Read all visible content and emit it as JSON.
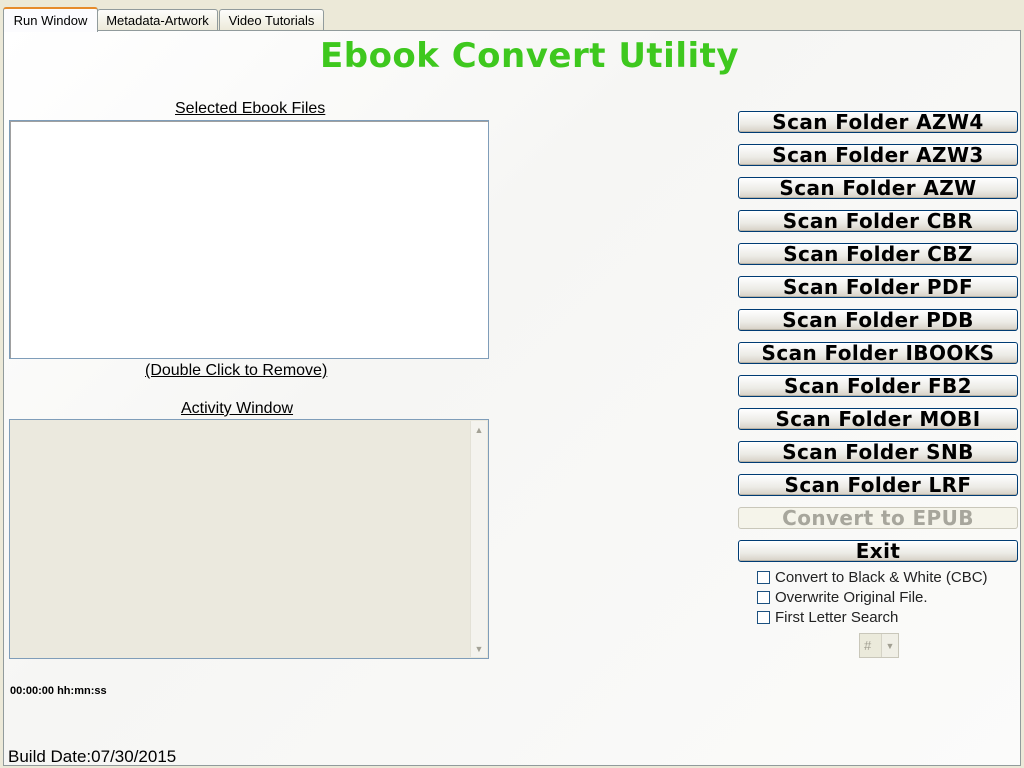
{
  "tabs": [
    {
      "label": "Run Window"
    },
    {
      "label": "Metadata-Artwork"
    },
    {
      "label": "Video Tutorials"
    }
  ],
  "title": "Ebook Convert Utility",
  "files_caption": "Selected Ebook Files",
  "remove_hint": "(Double Click to Remove)",
  "activity_caption": "Activity Window",
  "timer": "00:00:00 hh:mn:ss",
  "build_date": "Build Date:07/30/2015",
  "buttons": [
    {
      "label": "Scan Folder AZW4"
    },
    {
      "label": "Scan Folder AZW3"
    },
    {
      "label": "Scan Folder AZW"
    },
    {
      "label": "Scan Folder CBR"
    },
    {
      "label": "Scan Folder CBZ"
    },
    {
      "label": "Scan Folder PDF"
    },
    {
      "label": "Scan Folder PDB"
    },
    {
      "label": "Scan Folder IBOOKS"
    },
    {
      "label": "Scan Folder FB2"
    },
    {
      "label": "Scan Folder MOBI"
    },
    {
      "label": "Scan Folder SNB"
    },
    {
      "label": "Scan Folder LRF"
    },
    {
      "label": "Convert to EPUB",
      "disabled": true
    },
    {
      "label": "Exit"
    }
  ],
  "options": [
    {
      "label": "Convert to Black & White (CBC)",
      "checked": false
    },
    {
      "label": "Overwrite Original File.",
      "checked": false
    },
    {
      "label": "First Letter Search",
      "checked": false
    }
  ],
  "letter_select": {
    "value": "#"
  },
  "colors": {
    "title": "#3ec81e",
    "active_tab_accent": "#e68b2c"
  }
}
